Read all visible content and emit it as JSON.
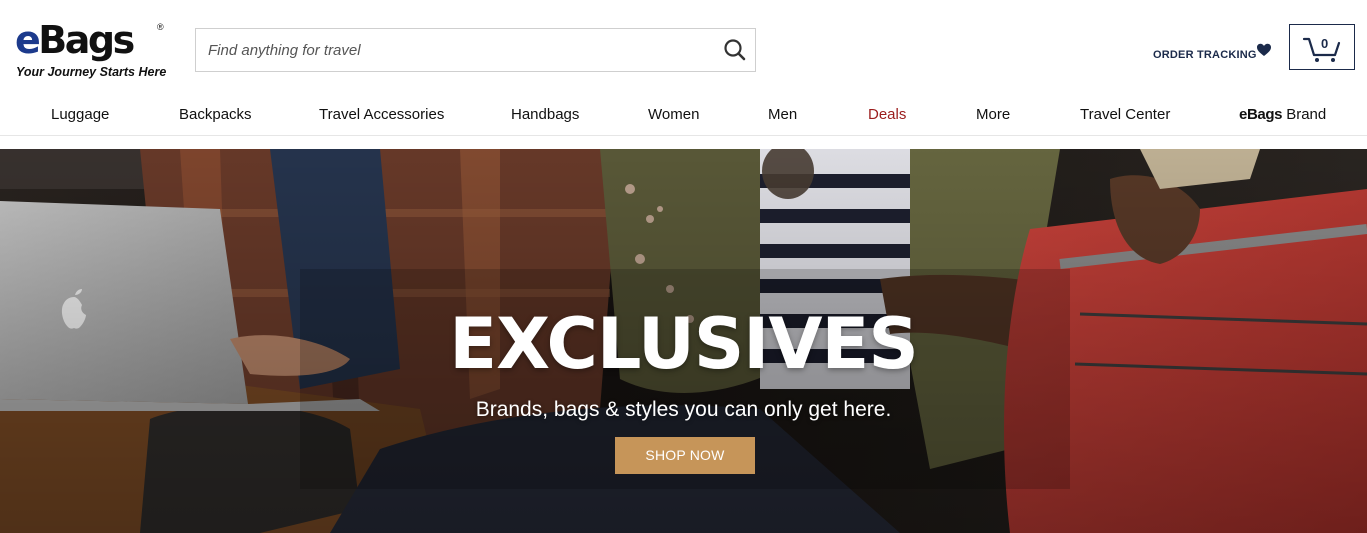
{
  "header": {
    "logo_text": "eBags",
    "logo_registered": "®",
    "logo_tagline": "Your Journey Starts Here",
    "search_placeholder": "Find anything for travel",
    "order_tracking": "ORDER TRACKING",
    "wishlist_icon": "heart-icon",
    "cart_icon": "cart-icon",
    "cart_count": "0",
    "brand_color": "#1c3a8c",
    "dark_navy": "#1b2a4a"
  },
  "nav": {
    "items": [
      {
        "label": "Luggage"
      },
      {
        "label": "Backpacks"
      },
      {
        "label": "Travel Accessories"
      },
      {
        "label": "Handbags"
      },
      {
        "label": "Women"
      },
      {
        "label": "Men"
      },
      {
        "label": "Deals"
      },
      {
        "label": "More"
      },
      {
        "label": "Travel Center"
      }
    ],
    "brand_item": {
      "bold": "eBags",
      "rest": " Brand"
    },
    "deals_color": "#9b1c1c"
  },
  "hero": {
    "title": "EXCLUSIVES",
    "subtitle": "Brands, bags & styles you can only get here.",
    "cta_label": "SHOP NOW",
    "cta_color": "#c69559"
  }
}
